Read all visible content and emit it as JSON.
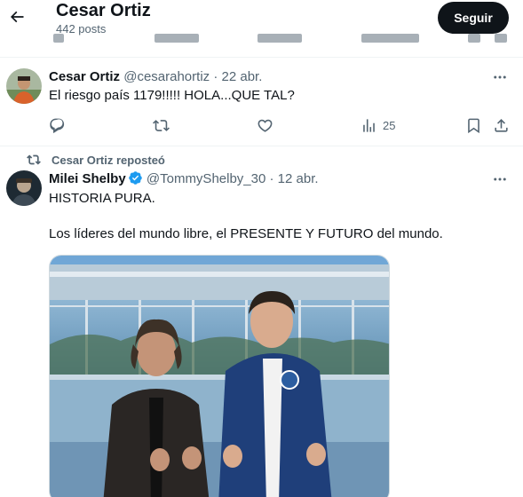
{
  "header": {
    "title": "Cesar Ortiz",
    "posts_count": "442 posts",
    "follow_label": "Seguir"
  },
  "tweet1": {
    "name": "Cesar Ortiz",
    "handle": "@cesarahortiz",
    "separator": "·",
    "date": "22 abr.",
    "text": "El riesgo país 1179!!!!! HOLA...QUE TAL?",
    "views": "25"
  },
  "repost": {
    "label": "Cesar Ortiz reposteó"
  },
  "tweet2": {
    "name": "Milei Shelby",
    "handle": "@TommyShelby_30",
    "separator": "·",
    "date": "12 abr.",
    "line1": "HISTORIA PURA.",
    "line2": "Los líderes del mundo libre, el PRESENTE Y FUTURO del mundo."
  },
  "colors": {
    "accent": "#0f1419",
    "muted": "#536471",
    "verified": "#1d9bf0",
    "divider": "#eff3f4"
  },
  "icons": [
    "back-arrow-icon",
    "reply-icon",
    "retweet-icon",
    "like-icon",
    "views-icon",
    "bookmark-icon",
    "share-icon",
    "more-icon",
    "verified-badge-icon"
  ]
}
